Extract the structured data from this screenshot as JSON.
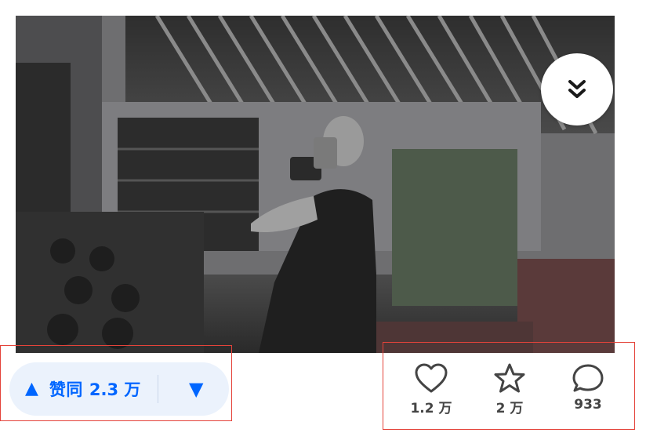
{
  "post": {
    "image_alt": "健身房自拍照片"
  },
  "collapse": {
    "icon": "double-chevron-down-icon"
  },
  "vote": {
    "up_label": "赞同",
    "up_count": "2.3 万",
    "up_icon": "triangle-up-icon",
    "down_icon": "triangle-down-icon",
    "color": "#0066ff",
    "background": "#ebf2fc"
  },
  "actions": {
    "like": {
      "icon": "heart-icon",
      "count": "1.2 万"
    },
    "favorite": {
      "icon": "star-icon",
      "count": "2 万"
    },
    "comment": {
      "icon": "comment-icon",
      "count": "933"
    }
  },
  "annotation_color": "#e4433a"
}
